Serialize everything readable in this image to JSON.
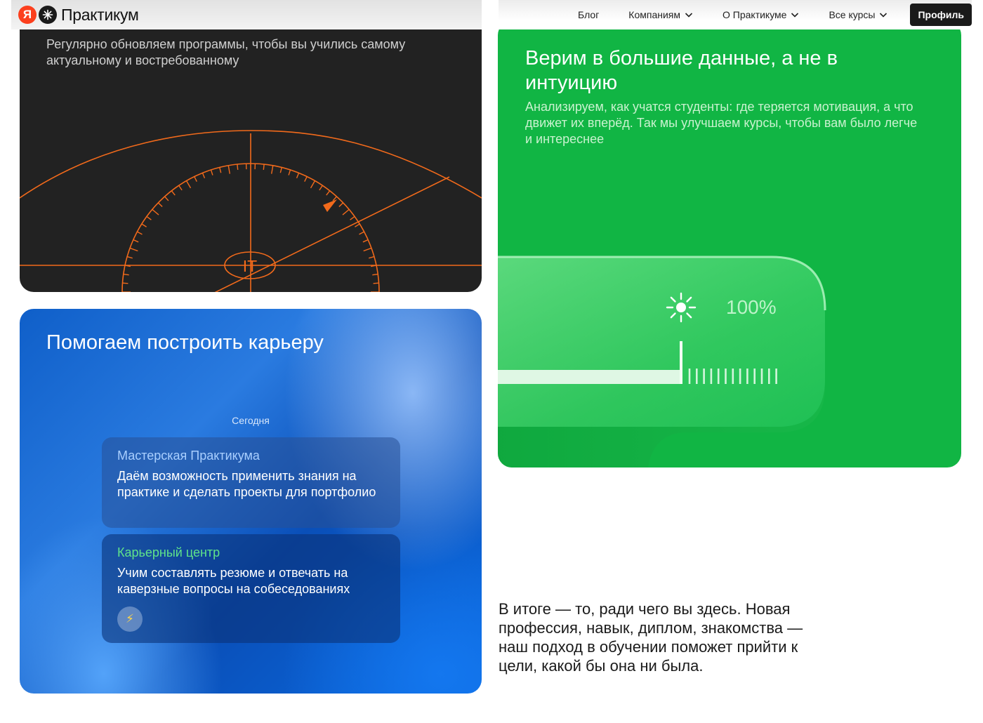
{
  "header": {
    "logo_ya": "Я",
    "logo_text": "Практикум",
    "nav": [
      {
        "label": "Блог",
        "has_dropdown": false
      },
      {
        "label": "Компаниям",
        "has_dropdown": true
      },
      {
        "label": "О Практикуме",
        "has_dropdown": true
      },
      {
        "label": "Все курсы",
        "has_dropdown": true
      }
    ],
    "profile_label": "Профиль"
  },
  "dark_card": {
    "description": "Регулярно обновляем программы, чтобы вы учились самому актуальному и востребованному",
    "gauge_label": "IT",
    "accent_color": "#f26a1b"
  },
  "green_card": {
    "title": "Верим в большие данные, а не в интуицию",
    "description": "Анализируем, как учатся студенты: где теряется мотивация, а что движет их вперёд. Так мы улучшаем курсы, чтобы вам было легче и интереснее",
    "progress_label": "100%",
    "progress_value": 1.0,
    "icon": "sun-icon"
  },
  "blue_card": {
    "title": "Помогаем построить карьеру",
    "today_label": "Сегодня",
    "bubbles": [
      {
        "title": "Мастерская Практикума",
        "text": "Даём возможность применить знания на практике и сделать проекты для портфолио"
      },
      {
        "title": "Карьерный центр",
        "text": "Учим составлять резюме и отвечать на каверзные вопросы на собеседованиях",
        "icon": "lightning-icon"
      }
    ]
  },
  "summary": {
    "text": "В итоге — то, ради чего вы здесь. Новая профессия, навык, диплом, знакомства — наш подход в обучении поможет прийти к цели, какой бы она ни была."
  }
}
